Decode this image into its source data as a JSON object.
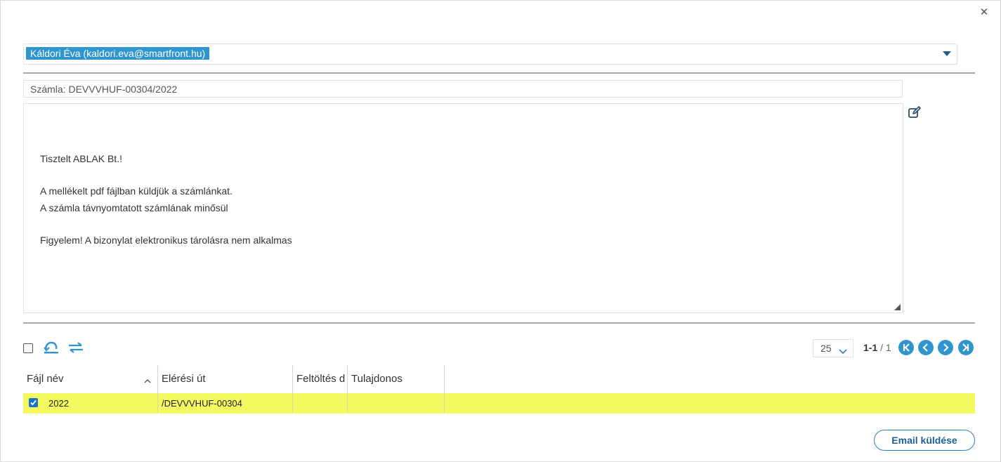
{
  "recipient": {
    "chip_label": "Káldori Éva (kaldori.eva@smartfront.hu)"
  },
  "subject": {
    "value": "Számla: DEVVVHUF-00304/2022"
  },
  "message": {
    "lines": [
      "Tisztelt ABLAK Bt.!",
      "A mellékelt pdf fájlban küldjük a számlánkat.",
      "A számla távnyomtatott számlának minősül",
      "Figyelem! A bizonylat elektronikus tárolásra nem alkalmas"
    ]
  },
  "pager": {
    "page_size": "25",
    "range": "1-1",
    "separator": "/",
    "total": "1"
  },
  "grid": {
    "columns": [
      "Fájl név",
      "Elérési út",
      "Feltöltés d",
      "Tulajdonos"
    ],
    "rows": [
      {
        "checked": true,
        "file_name": "2022",
        "path": "/DEVVVHUF-00304",
        "uploaded": "",
        "owner": ""
      }
    ]
  },
  "actions": {
    "send_label": "Email küldése"
  },
  "colors": {
    "accent": "#2f95cf",
    "row_highlight": "#f4f95f"
  },
  "icons": [
    "close-icon",
    "dropdown-caret-icon",
    "edit-icon",
    "refresh-icon",
    "swap-icon",
    "chevron-down-icon",
    "first-page-icon",
    "prev-page-icon",
    "next-page-icon",
    "last-page-icon",
    "sort-asc-icon",
    "checkbox-checked-icon"
  ]
}
